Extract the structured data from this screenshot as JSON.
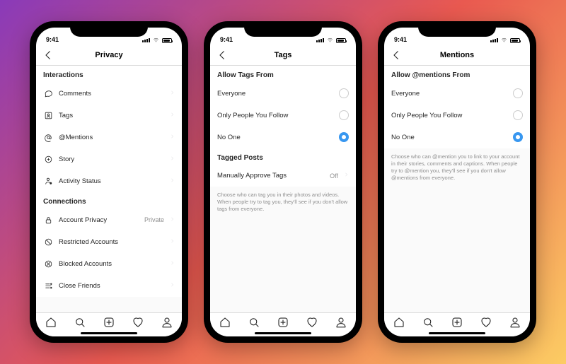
{
  "status": {
    "time": "9:41"
  },
  "phones": [
    {
      "title": "Privacy",
      "sections": [
        {
          "heading": "Interactions",
          "rows": [
            {
              "icon": "comment-icon",
              "label": "Comments",
              "chev": true
            },
            {
              "icon": "tag-icon",
              "label": "Tags",
              "chev": true
            },
            {
              "icon": "mention-icon",
              "label": "@Mentions",
              "chev": true
            },
            {
              "icon": "story-icon",
              "label": "Story",
              "chev": true
            },
            {
              "icon": "activity-icon",
              "label": "Activity Status",
              "chev": true
            }
          ]
        },
        {
          "heading": "Connections",
          "rows": [
            {
              "icon": "lock-icon",
              "label": "Account Privacy",
              "value": "Private",
              "chev": true
            },
            {
              "icon": "restricted-icon",
              "label": "Restricted Accounts",
              "chev": true
            },
            {
              "icon": "blocked-icon",
              "label": "Blocked Accounts",
              "chev": true
            },
            {
              "icon": "close-friends-icon",
              "label": "Close Friends",
              "chev": true
            }
          ]
        }
      ]
    },
    {
      "title": "Tags",
      "sections": [
        {
          "heading": "Allow Tags From",
          "rows": [
            {
              "label": "Everyone",
              "radio": false
            },
            {
              "label": "Only People You Follow",
              "radio": false
            },
            {
              "label": "No One",
              "radio": true
            }
          ]
        },
        {
          "heading": "Tagged Posts",
          "rows": [
            {
              "label": "Manually Approve Tags",
              "value": "Off",
              "chev": true
            }
          ],
          "help": "Choose who can tag you in their photos and videos. When people try to tag you, they'll see if you don't allow tags from everyone."
        }
      ]
    },
    {
      "title": "Mentions",
      "sections": [
        {
          "heading": "Allow @mentions From",
          "rows": [
            {
              "label": "Everyone",
              "radio": false
            },
            {
              "label": "Only People You Follow",
              "radio": false
            },
            {
              "label": "No One",
              "radio": true
            }
          ],
          "help": "Choose who can @mention you to link to your account in their stories, comments and captions. When people try to @mention you, they'll see if you don't allow @mentions from everyone."
        }
      ]
    }
  ]
}
